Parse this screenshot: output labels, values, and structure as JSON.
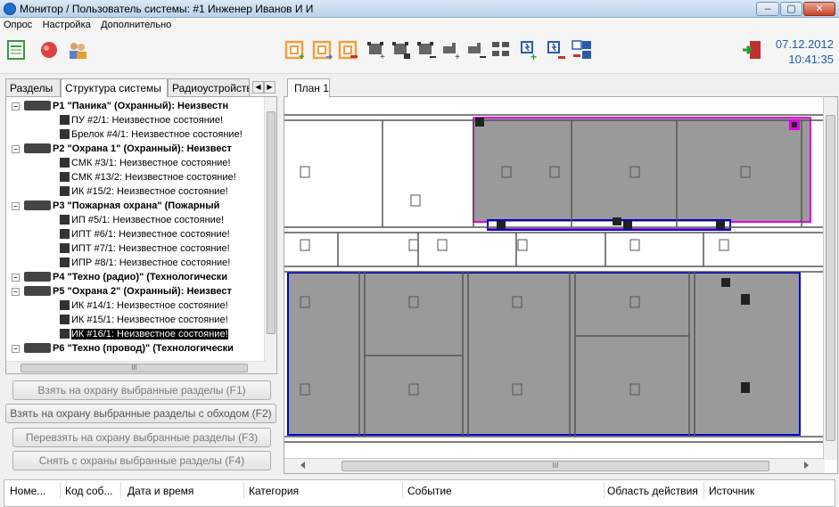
{
  "window": {
    "title": "Монитор / Пользователь системы: #1 Инженер Иванов И И",
    "controls": [
      "–",
      "▢",
      "✕"
    ]
  },
  "menu": [
    "Опрос",
    "Настройка",
    "Дополнительно"
  ],
  "toolbar": {
    "date": "07.12.2012",
    "time": "10:41:35"
  },
  "left_tabs": [
    "Разделы",
    "Структура системы",
    "Радиоустройства"
  ],
  "tree": [
    {
      "label": "Р1 \"Паника\" (Охранный): Неизвестн",
      "part": true
    },
    {
      "label": "ПУ #2/1: Неизвестное состояние!",
      "part": false
    },
    {
      "label": "Брелок #4/1: Неизвестное состояние!",
      "part": false
    },
    {
      "label": "Р2 \"Охрана 1\" (Охранный): Неизвест",
      "part": true
    },
    {
      "label": "СМК #3/1: Неизвестное состояние!",
      "part": false
    },
    {
      "label": "СМК #13/2: Неизвестное состояние!",
      "part": false
    },
    {
      "label": "ИК #15/2: Неизвестное состояние!",
      "part": false
    },
    {
      "label": "Р3 \"Пожарная охрана\" (Пожарный",
      "part": true
    },
    {
      "label": "ИП #5/1: Неизвестное состояние!",
      "part": false
    },
    {
      "label": "ИПТ #6/1: Неизвестное состояние!",
      "part": false
    },
    {
      "label": "ИПТ #7/1: Неизвестное состояние!",
      "part": false
    },
    {
      "label": "ИПР #8/1: Неизвестное состояние!",
      "part": false
    },
    {
      "label": "Р4 \"Техно (радио)\" (Технологически",
      "part": true
    },
    {
      "label": "Р5 \"Охрана 2\" (Охранный): Неизвест",
      "part": true
    },
    {
      "label": "ИК #14/1: Неизвестное состояние!",
      "part": false
    },
    {
      "label": "ИК #15/1: Неизвестное состояние!",
      "part": false
    },
    {
      "label": "ИК #16/1: Неизвестное состояние!",
      "part": false
    },
    {
      "label": "Р6 \"Техно (провод)\" (Технологически",
      "part": true
    }
  ],
  "tree_hscroll_label": "III",
  "buttons": [
    "Взять на охрану выбранные разделы (F1)",
    "Взять на охрану выбранные разделы с обходом (F2)",
    "Перевзять на охрану выбранные разделы (F3)",
    "Снять с охраны выбранные разделы (F4)"
  ],
  "plan_tab": "План 1",
  "plan_hscroll_label": "III",
  "event_columns": [
    "Номе...",
    "Код соб...",
    "Дата и время",
    "Категория",
    "Событие",
    "Область действия",
    "Источник"
  ],
  "colors": {
    "date_text": "#1f5ea8",
    "zone_magenta": "#e000e0",
    "zone_blue": "#0000cc",
    "zone_fill": "#9a9a9a",
    "toolbar_orange": "#f0a040"
  }
}
